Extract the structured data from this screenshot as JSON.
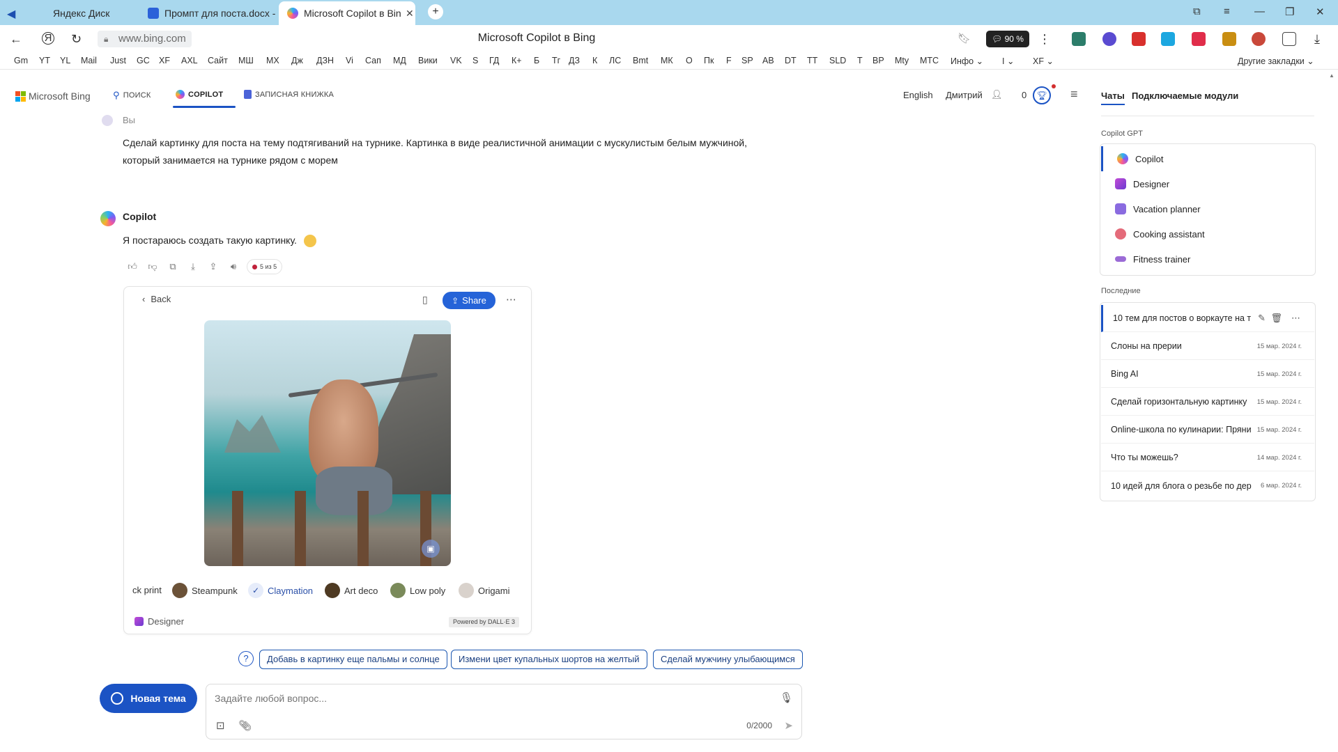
{
  "browser": {
    "tabs": [
      {
        "title": "Яндекс Диск",
        "active": false
      },
      {
        "title": "Промпт для поста.docx - ",
        "active": false
      },
      {
        "title": "Microsoft Copilot в Bing",
        "active": true
      }
    ],
    "url": "www.bing.com",
    "page_title": "Microsoft Copilot в Bing",
    "zoom": "90 %",
    "bookmarks": [
      "Gm",
      "YT",
      "YL",
      "Mail",
      "Just",
      "GC",
      "XF",
      "AXL",
      "Сайт",
      "МШ",
      "МХ",
      "Дж",
      "ДЗН",
      "Vi",
      "Сап",
      "МД",
      "Вики",
      "VK",
      "S",
      "ГД",
      "К+",
      "Б",
      "Тг",
      "ДЗ",
      "К",
      "ЛС",
      "Bmt",
      "МК",
      "О",
      "Пк",
      "F",
      "SP",
      "АВ",
      "DT",
      "TT",
      "SLD",
      "T",
      "BP",
      "Mty",
      "МТС",
      "Инфо",
      "I",
      "XF"
    ],
    "other_bookmarks": "Другие закладки"
  },
  "bing": {
    "logo": "Microsoft Bing",
    "nav": {
      "search": "ПОИСК",
      "copilot": "COPILOT",
      "notebook": "ЗАПИСНАЯ КНИЖКА"
    },
    "language": "English",
    "user": "Дмитрий",
    "points": "0"
  },
  "chat": {
    "user_label": "Вы",
    "user_message_line1": "Сделай картинку для поста на тему подтягиваний на турнике. Картинка в виде реалистичной анимации с мускулистым белым мужчиной,",
    "user_message_line2": "который занимается на турнике рядом с морем",
    "copilot_label": "Copilot",
    "copilot_message": "Я постараюсь создать такую картинку.",
    "counter": "5 из 5",
    "card": {
      "back": "Back",
      "share": "Share",
      "styles": [
        "ck print",
        "Steampunk",
        "Claymation",
        "Art deco",
        "Low poly",
        "Origami"
      ],
      "designer": "Designer",
      "powered": "Powered by DALL·E 3"
    },
    "suggestions": [
      "Добавь в картинку еще пальмы и солнце",
      "Измени цвет купальных шортов на желтый",
      "Сделай мужчину улыбающимся"
    ],
    "new_topic": "Новая тема",
    "input_placeholder": "Задайте любой вопрос...",
    "char_count": "0/2000"
  },
  "sidebar": {
    "tabs": {
      "chats": "Чаты",
      "plugins": "Подключаемые модули"
    },
    "gpt_header": "Copilot GPT",
    "gpts": [
      "Copilot",
      "Designer",
      "Vacation planner",
      "Cooking assistant",
      "Fitness trainer"
    ],
    "recent_header": "Последние",
    "recent": [
      {
        "title": "10 тем для постов о воркауте на т",
        "date": ""
      },
      {
        "title": "Слоны на прерии",
        "date": "15 мар. 2024 г."
      },
      {
        "title": "Bing AI",
        "date": "15 мар. 2024 г."
      },
      {
        "title": "Сделай горизонтальную картинку",
        "date": "15 мар. 2024 г."
      },
      {
        "title": "Online-школа по кулинарии: Пряни",
        "date": "15 мар. 2024 г."
      },
      {
        "title": "Что ты можешь?",
        "date": "14 мар. 2024 г."
      },
      {
        "title": "10 идей для блога о резьбе по дер",
        "date": "6 мар. 2024 г."
      }
    ]
  },
  "colors": {
    "tabstrip": "#a9d8ee",
    "accent_blue": "#1b53c4",
    "share_blue": "#2563d8"
  }
}
